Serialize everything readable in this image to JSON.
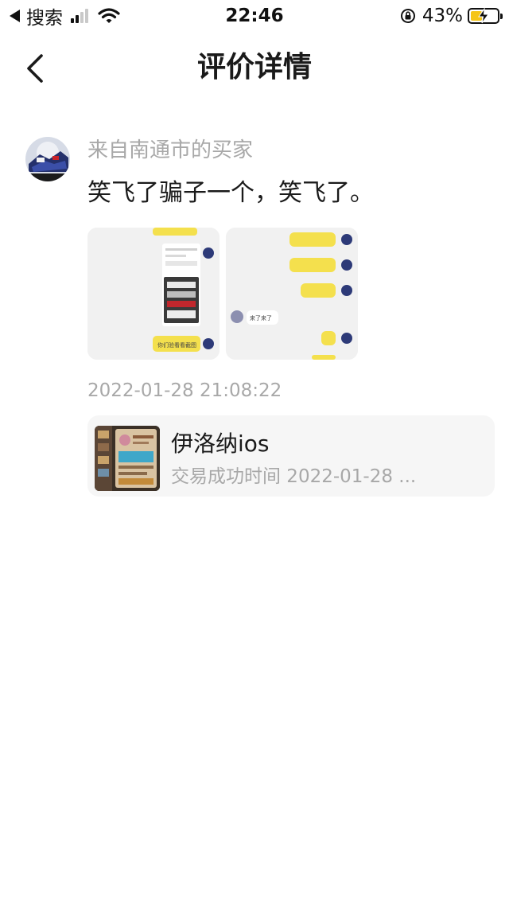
{
  "status_bar": {
    "back_app": "搜索",
    "time": "22:46",
    "battery_percent": "43%",
    "battery_level": 0.43,
    "signal_bars_on": 2,
    "signal_bars_total": 4
  },
  "nav": {
    "title": "评价详情",
    "back_icon": "chevron-left-icon"
  },
  "review": {
    "reviewer": "来自南通市的买家",
    "text": "笑飞了骗子一个，笑飞了。",
    "date": "2022-01-28 21:08:22",
    "images": [
      {
        "chat_lines": [
          "你们验看看截图"
        ]
      },
      {
        "chat_lines": [
          "来了来了"
        ]
      }
    ]
  },
  "item": {
    "title": "伊洛纳ios",
    "subtitle": "交易成功时间 2022-01-28 ..."
  },
  "colors": {
    "accent_yellow": "#f5c518",
    "secondary_text": "#a8a8a8",
    "card_bg": "#f6f6f6"
  }
}
